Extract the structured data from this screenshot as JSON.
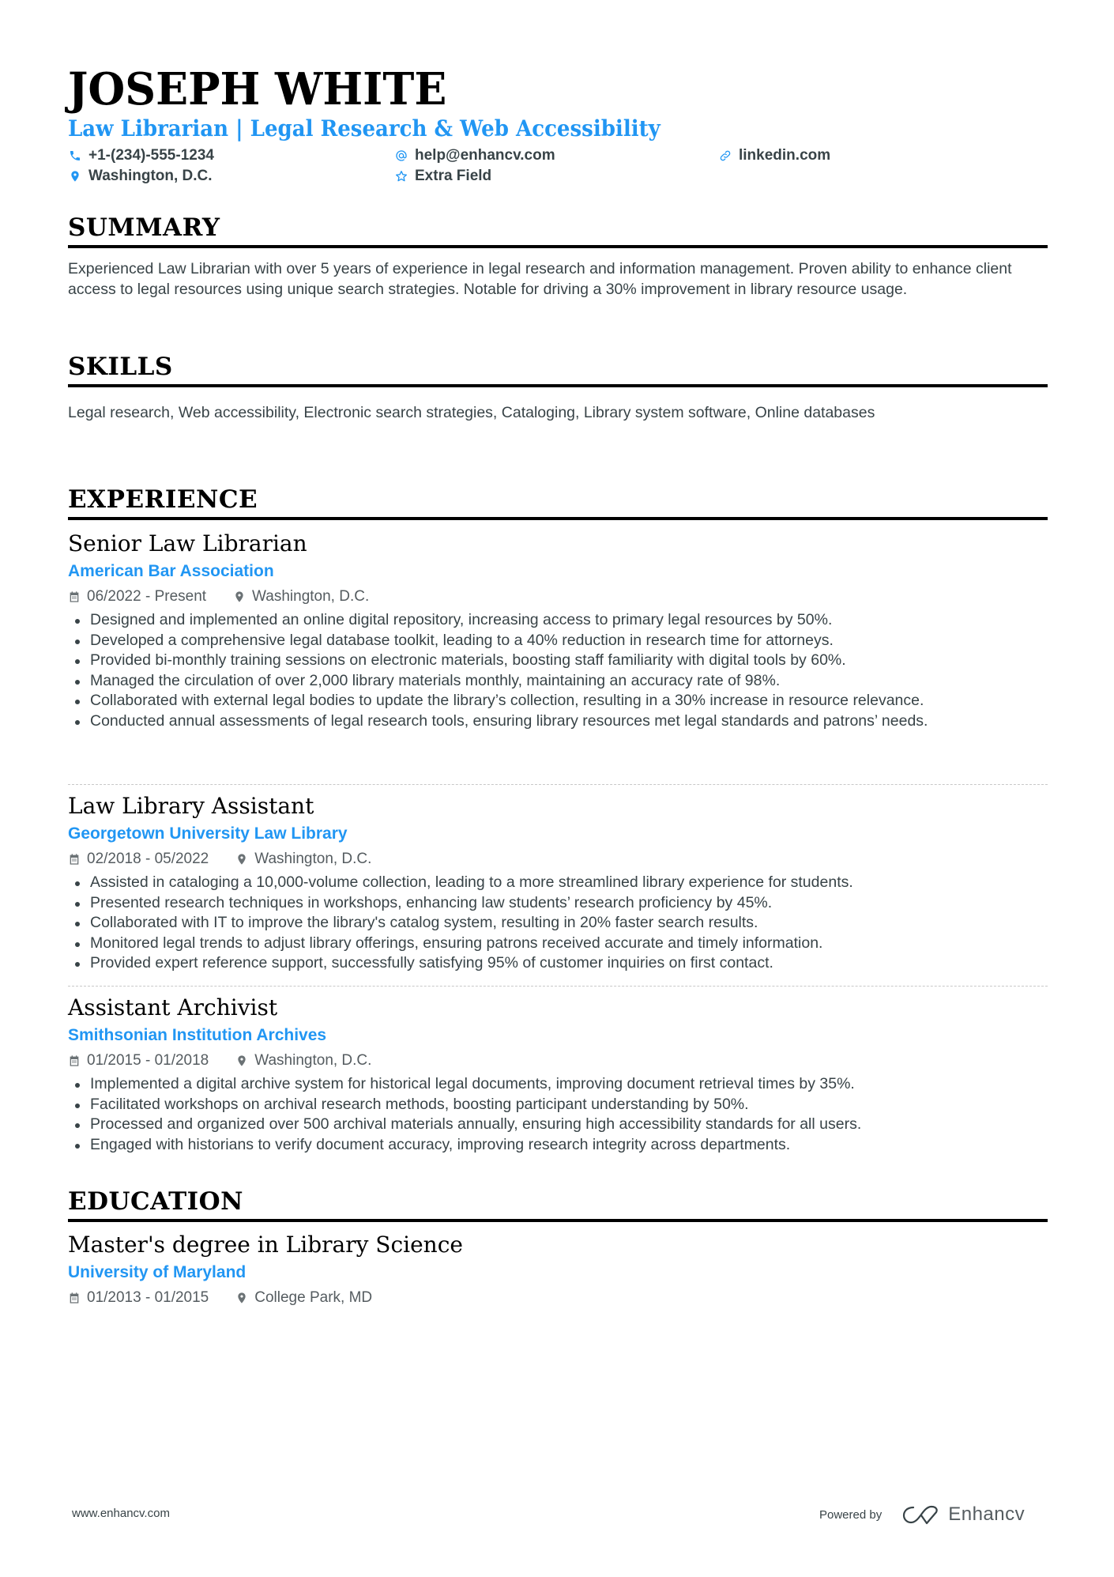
{
  "header": {
    "name": "JOSEPH WHITE",
    "title": "Law Librarian | Legal Research & Web Accessibility",
    "contacts": {
      "phone": "+1-(234)-555-1234",
      "email": "help@enhancv.com",
      "link": "linkedin.com",
      "location": "Washington, D.C.",
      "extra": "Extra Field"
    },
    "icons": {
      "phone": "phone-icon",
      "email": "at-icon",
      "link": "link-icon",
      "location": "map-pin-icon",
      "extra": "star-icon"
    }
  },
  "sections": {
    "summary": {
      "heading": "SUMMARY",
      "text": "Experienced Law Librarian with over 5 years of experience in legal research and information management. Proven ability to enhance client access to legal resources using unique search strategies. Notable for driving a 30% improvement in library resource usage."
    },
    "skills": {
      "heading": "SKILLS",
      "text": "Legal research, Web accessibility, Electronic search strategies, Cataloging, Library system software, Online databases"
    },
    "experience": {
      "heading": "EXPERIENCE",
      "jobs": [
        {
          "title": "Senior Law Librarian",
          "company": "American Bar Association",
          "dates": "06/2022 - Present",
          "location": "Washington, D.C.",
          "bullets": [
            "Designed and implemented an online digital repository, increasing access to primary legal resources by 50%.",
            "Developed a comprehensive legal database toolkit, leading to a 40% reduction in research time for attorneys.",
            "Provided bi-monthly training sessions on electronic materials, boosting staff familiarity with digital tools by 60%.",
            "Managed the circulation of over 2,000 library materials monthly, maintaining an accuracy rate of 98%.",
            "Collaborated with external legal bodies to update the library’s collection, resulting in a 30% increase in resource relevance.",
            "Conducted annual assessments of legal research tools, ensuring library resources met legal standards and patrons’ needs."
          ]
        },
        {
          "title": "Law Library Assistant",
          "company": "Georgetown University Law Library",
          "dates": "02/2018 - 05/2022",
          "location": "Washington, D.C.",
          "bullets": [
            "Assisted in cataloging a 10,000-volume collection, leading to a more streamlined library experience for students.",
            "Presented research techniques in workshops, enhancing law students’ research proficiency by 45%.",
            "Collaborated with IT to improve the library's catalog system, resulting in 20% faster search results.",
            "Monitored legal trends to adjust library offerings, ensuring patrons received accurate and timely information.",
            "Provided expert reference support, successfully satisfying 95% of customer inquiries on first contact."
          ]
        },
        {
          "title": "Assistant Archivist",
          "company": "Smithsonian Institution Archives",
          "dates": "01/2015 - 01/2018",
          "location": "Washington, D.C.",
          "bullets": [
            "Implemented a digital archive system for historical legal documents, improving document retrieval times by 35%.",
            "Facilitated workshops on archival research methods, boosting participant understanding by 50%.",
            "Processed and organized over 500 archival materials annually, ensuring high accessibility standards for all users.",
            "Engaged with historians to verify document accuracy, improving research integrity across departments."
          ]
        }
      ]
    },
    "education": {
      "heading": "EDUCATION",
      "items": [
        {
          "degree": "Master's degree in Library Science",
          "school": "University of Maryland",
          "dates": "01/2013 - 01/2015",
          "location": "College Park, MD"
        }
      ]
    }
  },
  "footer": {
    "website": "www.enhancv.com",
    "powered_by": "Powered by",
    "brand": "Enhancv"
  },
  "colors": {
    "accent": "#2196f3",
    "text": "#384347",
    "heading": "#000000"
  }
}
